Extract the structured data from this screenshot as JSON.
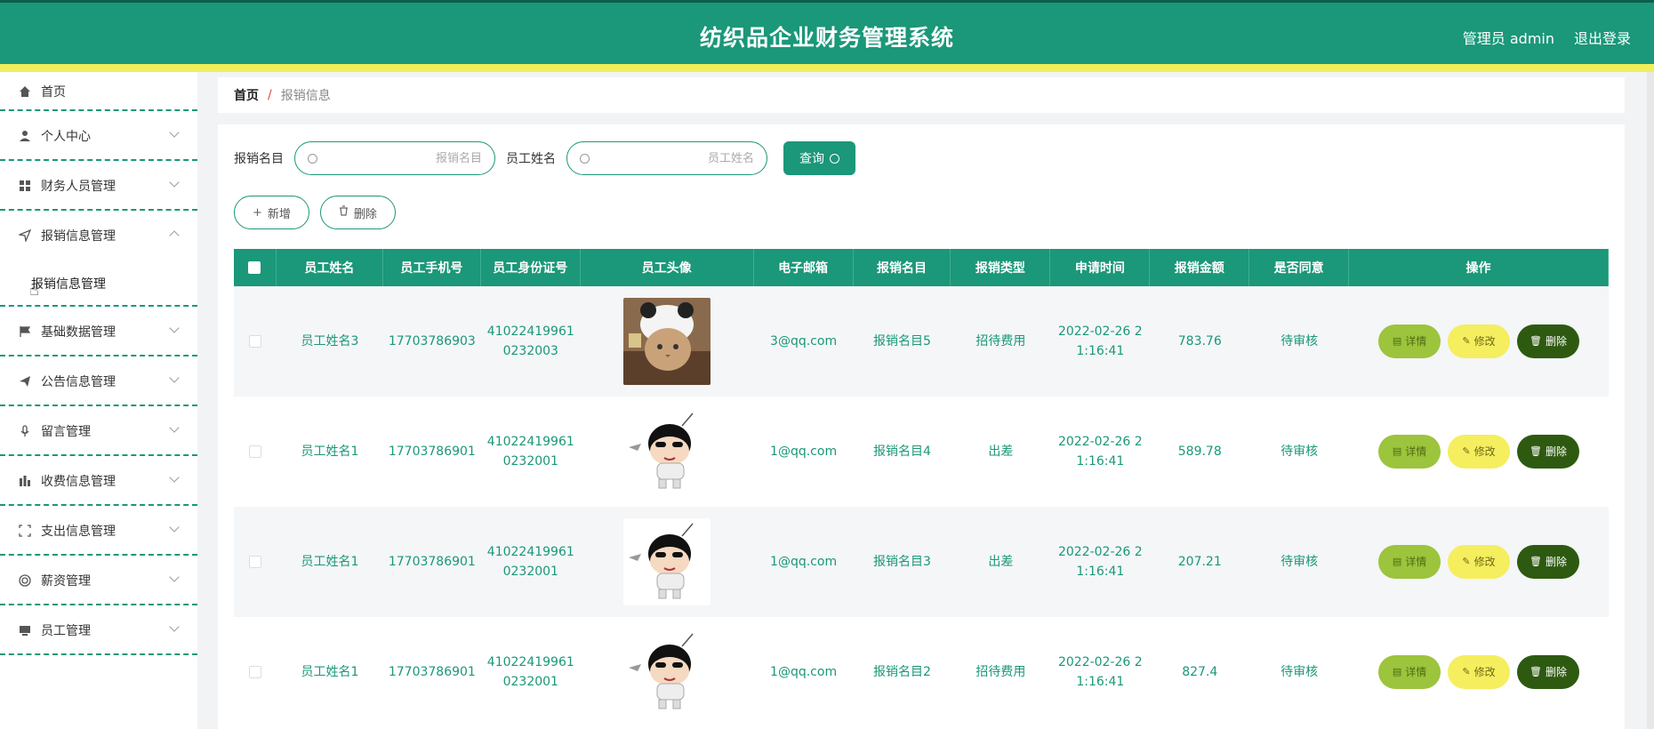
{
  "header": {
    "title": "纺织品企业财务管理系统",
    "user": "管理员 admin",
    "logout": "退出登录",
    "colors": {
      "primary": "#1b9779",
      "stripe": "#f0ee5a"
    }
  },
  "sidebar": {
    "items": [
      {
        "label": "首页",
        "icon": "home-icon"
      },
      {
        "label": "个人中心",
        "icon": "user-icon"
      },
      {
        "label": "财务人员管理",
        "icon": "grid-icon"
      },
      {
        "label": "报销信息管理",
        "icon": "send-icon"
      },
      {
        "label": "基础数据管理",
        "icon": "flag-icon"
      },
      {
        "label": "公告信息管理",
        "icon": "paper-plane-icon"
      },
      {
        "label": "留言管理",
        "icon": "microphone-icon"
      },
      {
        "label": "收费信息管理",
        "icon": "bar-chart-icon"
      },
      {
        "label": "支出信息管理",
        "icon": "frame-icon"
      },
      {
        "label": "薪资管理",
        "icon": "circle-icon"
      },
      {
        "label": "员工管理",
        "icon": "monitor-icon"
      }
    ],
    "submenu": {
      "label": "报销信息管理"
    }
  },
  "breadcrumb": {
    "home": "首页",
    "sep": "/",
    "current": "报销信息"
  },
  "search": {
    "label1": "报销名目",
    "placeholder1": "报销名目",
    "label2": "员工姓名",
    "placeholder2": "员工姓名",
    "query": "查询"
  },
  "actions": {
    "add": "新增",
    "delete": "删除"
  },
  "table": {
    "headers": [
      "员工姓名",
      "员工手机号",
      "员工身份证号",
      "员工头像",
      "电子邮箱",
      "报销名目",
      "报销类型",
      "申请时间",
      "报销金额",
      "是否同意",
      "操作"
    ],
    "rows": [
      {
        "name": "员工姓名3",
        "phone": "17703786903",
        "id_line1": "41022419961",
        "id_line2": "0232003",
        "email": "3@qq.com",
        "item": "报销名目5",
        "type": "招待费用",
        "time_line1": "2022-02-26 2",
        "time_line2": "1:16:41",
        "amount": "783.76",
        "status": "待审核",
        "avatar": "cat"
      },
      {
        "name": "员工姓名1",
        "phone": "17703786901",
        "id_line1": "41022419961",
        "id_line2": "0232001",
        "email": "1@qq.com",
        "item": "报销名目4",
        "type": "出差",
        "time_line1": "2022-02-26 2",
        "time_line2": "1:16:41",
        "amount": "589.78",
        "status": "待审核",
        "avatar": "cartoon"
      },
      {
        "name": "员工姓名1",
        "phone": "17703786901",
        "id_line1": "41022419961",
        "id_line2": "0232001",
        "email": "1@qq.com",
        "item": "报销名目3",
        "type": "出差",
        "time_line1": "2022-02-26 2",
        "time_line2": "1:16:41",
        "amount": "207.21",
        "status": "待审核",
        "avatar": "cartoon"
      },
      {
        "name": "员工姓名1",
        "phone": "17703786901",
        "id_line1": "41022419961",
        "id_line2": "0232001",
        "email": "1@qq.com",
        "item": "报销名目2",
        "type": "招待费用",
        "time_line1": "2022-02-26 2",
        "time_line2": "1:16:41",
        "amount": "827.4",
        "status": "待审核",
        "avatar": "cartoon"
      }
    ],
    "op_labels": {
      "detail": "详情",
      "edit": "修改",
      "delete": "删除"
    }
  }
}
